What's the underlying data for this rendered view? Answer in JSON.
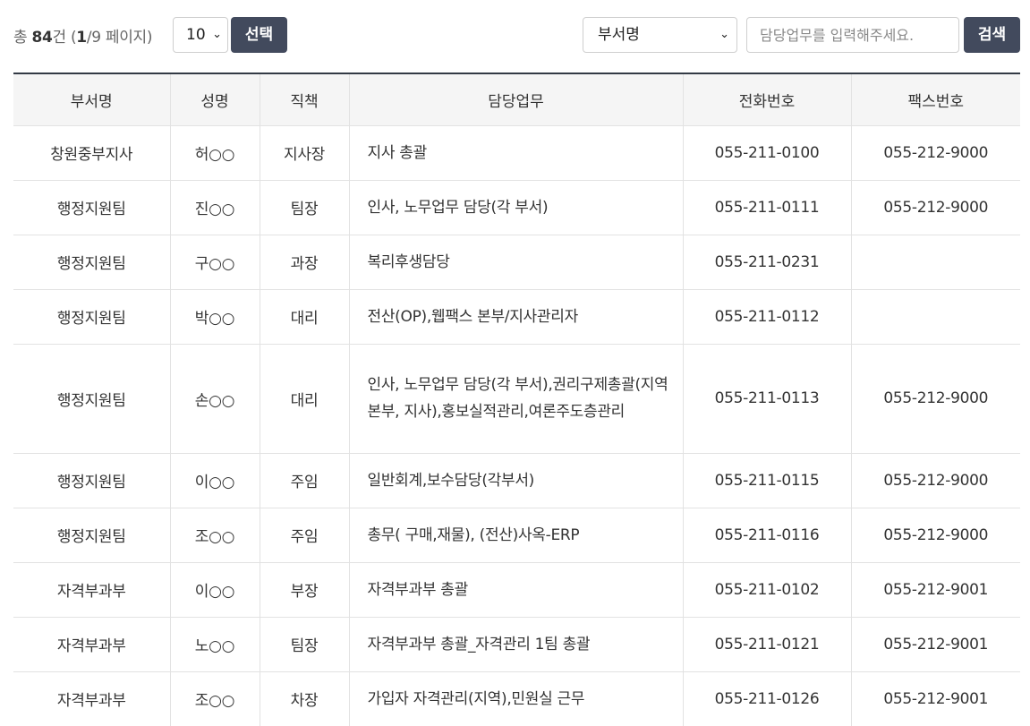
{
  "toolbar": {
    "count_prefix": "총 ",
    "total": "84",
    "count_unit": "건 (",
    "page_current": "1",
    "page_rest": "/9 페이지)",
    "page_size": "10",
    "choose_label": "선택",
    "dept_select": "부서명",
    "search_placeholder": "담당업무를 입력해주세요.",
    "search_label": "검색",
    "chevron_glyph": "⌄"
  },
  "table": {
    "headers": [
      "부서명",
      "성명",
      "직책",
      "담당업무",
      "전화번호",
      "팩스번호"
    ],
    "rows": [
      [
        "창원중부지사",
        "허○○",
        "지사장",
        "지사 총괄",
        "055-211-0100",
        "055-212-9000"
      ],
      [
        "행정지원팀",
        "진○○",
        "팀장",
        "인사, 노무업무 담당(각 부서)",
        "055-211-0111",
        "055-212-9000"
      ],
      [
        "행정지원팀",
        "구○○",
        "과장",
        "복리후생담당",
        "055-211-0231",
        ""
      ],
      [
        "행정지원팀",
        "박○○",
        "대리",
        "전산(OP),웹팩스 본부/지사관리자",
        "055-211-0112",
        ""
      ],
      [
        "행정지원팀",
        "손○○",
        "대리",
        "인사, 노무업무 담당(각 부서),권리구제총괄(지역본부, 지사),홍보실적관리,여론주도층관리",
        "055-211-0113",
        "055-212-9000"
      ],
      [
        "행정지원팀",
        "이○○",
        "주임",
        "일반회계,보수담당(각부서)",
        "055-211-0115",
        "055-212-9000"
      ],
      [
        "행정지원팀",
        "조○○",
        "주임",
        "총무( 구매,재물), (전산)사옥-ERP",
        "055-211-0116",
        "055-212-9000"
      ],
      [
        "자격부과부",
        "이○○",
        "부장",
        "자격부과부 총괄",
        "055-211-0102",
        "055-212-9001"
      ],
      [
        "자격부과부",
        "노○○",
        "팀장",
        "자격부과부 총괄_자격관리 1팀 총괄",
        "055-211-0121",
        "055-212-9001"
      ],
      [
        "자격부과부",
        "조○○",
        "차장",
        "가입자 자격관리(지역),민원실 근무",
        "055-211-0126",
        "055-212-9001"
      ]
    ]
  }
}
